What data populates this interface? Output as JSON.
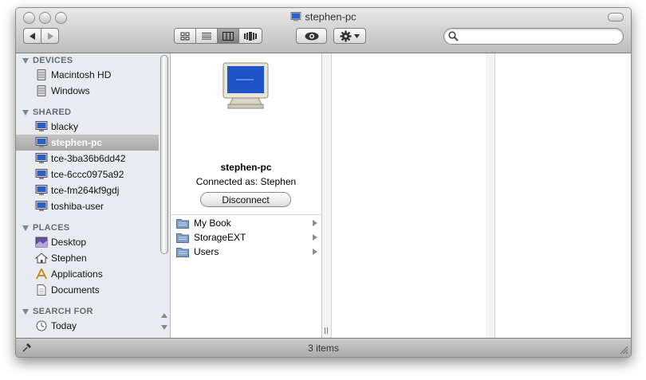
{
  "window": {
    "title": "stephen-pc"
  },
  "toolbar": {
    "back_icon": "back-arrow-icon",
    "forward_icon": "forward-arrow-icon",
    "view_modes": [
      "icon-view",
      "list-view",
      "column-view",
      "cover-flow-view"
    ],
    "active_view": "column-view",
    "quicklook_icon": "eye-icon",
    "action_icon": "gear-icon",
    "search_placeholder": ""
  },
  "sidebar": {
    "devices_header": "DEVICES",
    "devices": [
      {
        "label": "Macintosh HD",
        "icon": "hard-drive-icon"
      },
      {
        "label": "Windows",
        "icon": "hard-drive-icon"
      }
    ],
    "shared_header": "SHARED",
    "shared": [
      {
        "label": "blacky",
        "icon": "pc-icon"
      },
      {
        "label": "stephen-pc",
        "icon": "pc-icon",
        "selected": true
      },
      {
        "label": "tce-3ba36b6dd42",
        "icon": "pc-icon"
      },
      {
        "label": "tce-6ccc0975a92",
        "icon": "pc-icon"
      },
      {
        "label": "tce-fm264kf9gdj",
        "icon": "pc-icon"
      },
      {
        "label": "toshiba-user",
        "icon": "pc-icon"
      }
    ],
    "places_header": "PLACES",
    "places": [
      {
        "label": "Desktop",
        "icon": "desktop-icon"
      },
      {
        "label": "Stephen",
        "icon": "home-icon"
      },
      {
        "label": "Applications",
        "icon": "applications-icon"
      },
      {
        "label": "Documents",
        "icon": "documents-icon"
      }
    ],
    "search_header": "SEARCH FOR",
    "search": [
      {
        "label": "Today",
        "icon": "clock-icon"
      }
    ]
  },
  "preview": {
    "name": "stephen-pc",
    "connected_as": "Connected as: Stephen",
    "disconnect_label": "Disconnect"
  },
  "shares": [
    {
      "label": "My Book"
    },
    {
      "label": "StorageEXT"
    },
    {
      "label": "Users"
    }
  ],
  "status": {
    "text": "3 items"
  },
  "colors": {
    "sidebar_bg": "#e8ecf1",
    "selection": "#b4b4b4",
    "share_folder": "#7fa1c9"
  }
}
